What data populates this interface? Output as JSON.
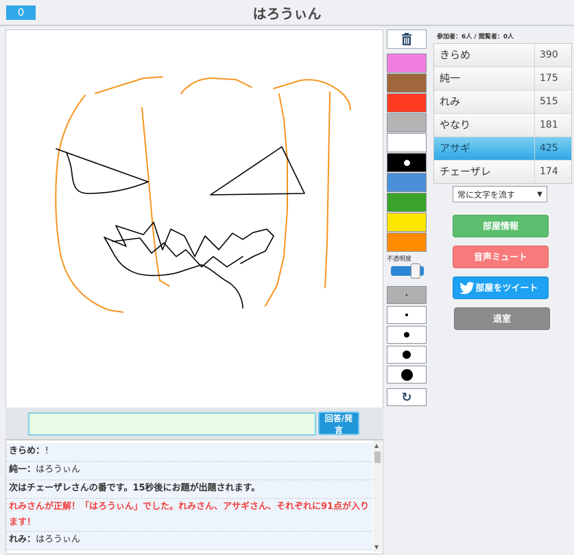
{
  "header": {
    "counter": "0",
    "title": "はろうぃん"
  },
  "answer": {
    "placeholder": "",
    "submit_label": "回答/発言"
  },
  "chat": {
    "messages": [
      {
        "name": "きらめ",
        "sep": "：",
        "text": "！"
      },
      {
        "name": "純一",
        "sep": "：",
        "text": "はろうぃん"
      },
      {
        "system": "次はチェーザレさんの番です。15秒後にお題が出題されます。"
      },
      {
        "alert": "れみさんが正解！「はろうぃん」でした。れみさん、アサギさん、それぞれに91点が入ります！"
      },
      {
        "name": "れみ",
        "sep": "：",
        "text": "はろうぃん"
      }
    ]
  },
  "tools": {
    "colors": [
      "#f07ee0",
      "#a0663c",
      "#ff3a22",
      "#b4b4b4",
      "#ffffff",
      "#000000",
      "#4a90d9",
      "#3aa52a",
      "#ffe600",
      "#ff8c00"
    ],
    "opacity_label": "不透明度",
    "opacity_value": 0.75,
    "undo_icon": "undo-icon",
    "trash_icon": "trash-icon"
  },
  "room": {
    "participants_info": "参加者：6人 / 閲覧者：0人",
    "players": [
      {
        "name": "きらめ",
        "score": "390"
      },
      {
        "name": "純一",
        "score": "175"
      },
      {
        "name": "れみ",
        "score": "515"
      },
      {
        "name": "やなり",
        "score": "181"
      },
      {
        "name": "アサギ",
        "score": "425",
        "highlight": true
      },
      {
        "name": "チェーザレ",
        "score": "174"
      }
    ],
    "select_value": "常に文字を流す",
    "buttons": {
      "info": "部屋情報",
      "mute": "音声ミュート",
      "tweet": "部屋をツイート",
      "exit": "退室"
    }
  },
  "colors": {
    "accent": "#2fa8e8",
    "green": "#5bbe6e",
    "red": "#f97a7a",
    "twitter": "#1da1f2",
    "gray": "#8c8c8c",
    "stroke_orange": "#f7941d",
    "stroke_black": "#000000"
  }
}
